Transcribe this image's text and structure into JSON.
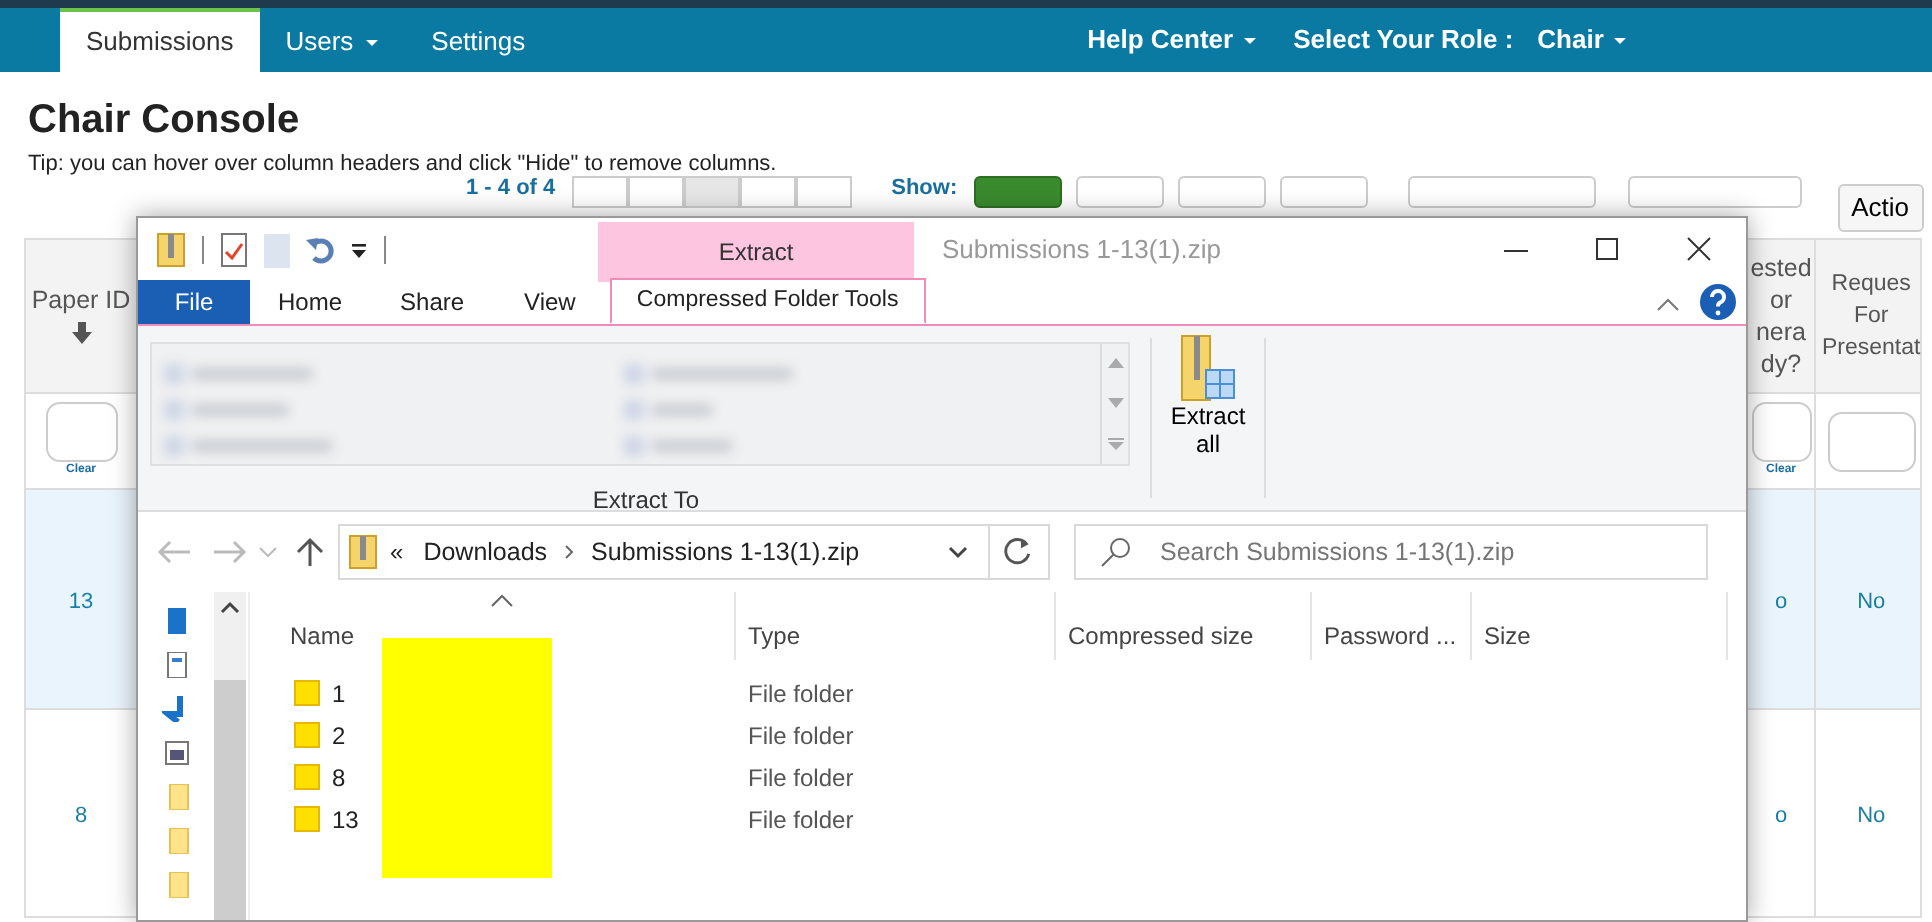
{
  "navbar": {
    "tabs": [
      {
        "label": "Submissions",
        "selected": true,
        "dropdown": false
      },
      {
        "label": "Users",
        "selected": false,
        "dropdown": true
      },
      {
        "label": "Settings",
        "selected": false,
        "dropdown": false
      }
    ],
    "right_items": [
      {
        "label": "Help Center",
        "dropdown": true
      },
      {
        "label": "Select Your Role :",
        "dropdown": false
      },
      {
        "label": "Chair",
        "dropdown": true
      }
    ]
  },
  "page": {
    "title": "Chair Console",
    "tip": "Tip: you can hover over column headers and click \"Hide\" to remove columns.",
    "pager_text": "1 - 4 of 4",
    "pager_buttons": [
      {
        "selected": false
      },
      {
        "selected": false
      },
      {
        "selected": true
      },
      {
        "selected": false
      },
      {
        "selected": false
      }
    ],
    "show_label": "Show:",
    "page_sizes": [
      {
        "selected": true
      },
      {
        "selected": false
      },
      {
        "selected": false
      },
      {
        "selected": false
      }
    ],
    "action_button": "Actio"
  },
  "table": {
    "columns": [
      {
        "label": "Paper ID",
        "sorted": true,
        "clear": "Clear"
      },
      {
        "label": "ested or nera dy?",
        "sorted": false,
        "clear": "Clear"
      },
      {
        "label": "Reques For Presentat",
        "sorted": false
      }
    ],
    "rows": [
      {
        "cells": [
          "13",
          "o",
          "No"
        ],
        "selected": true
      },
      {
        "cells": [
          "8",
          "o",
          "No"
        ],
        "selected": false
      }
    ]
  },
  "explorer": {
    "title": "Submissions 1-13(1).zip",
    "context_tab": "Extract",
    "ribbon_tabs": [
      {
        "label": "File",
        "kind": "file",
        "selected": false
      },
      {
        "label": "Home",
        "kind": "tab",
        "selected": false
      },
      {
        "label": "Share",
        "kind": "tab",
        "selected": false
      },
      {
        "label": "View",
        "kind": "tab",
        "selected": false
      },
      {
        "label": "Compressed Folder Tools",
        "kind": "tab",
        "selected": true
      }
    ],
    "ribbon_button": "Extract all",
    "group_label": "Extract To",
    "address": {
      "overflow": "«",
      "parts": [
        "Downloads",
        "Submissions 1-13(1).zip"
      ]
    },
    "search": {
      "placeholder": "Search Submissions 1-13(1).zip"
    },
    "columns": [
      {
        "label": "Name",
        "sorted": true
      },
      {
        "label": "Type",
        "sorted": false
      },
      {
        "label": "Compressed size",
        "sorted": false
      },
      {
        "label": "Password ...",
        "sorted": false
      },
      {
        "label": "Size",
        "sorted": false
      }
    ],
    "files": [
      {
        "name": "1",
        "type": "File folder"
      },
      {
        "name": "2",
        "type": "File folder"
      },
      {
        "name": "8",
        "type": "File folder"
      },
      {
        "name": "13",
        "type": "File folder"
      }
    ]
  }
}
